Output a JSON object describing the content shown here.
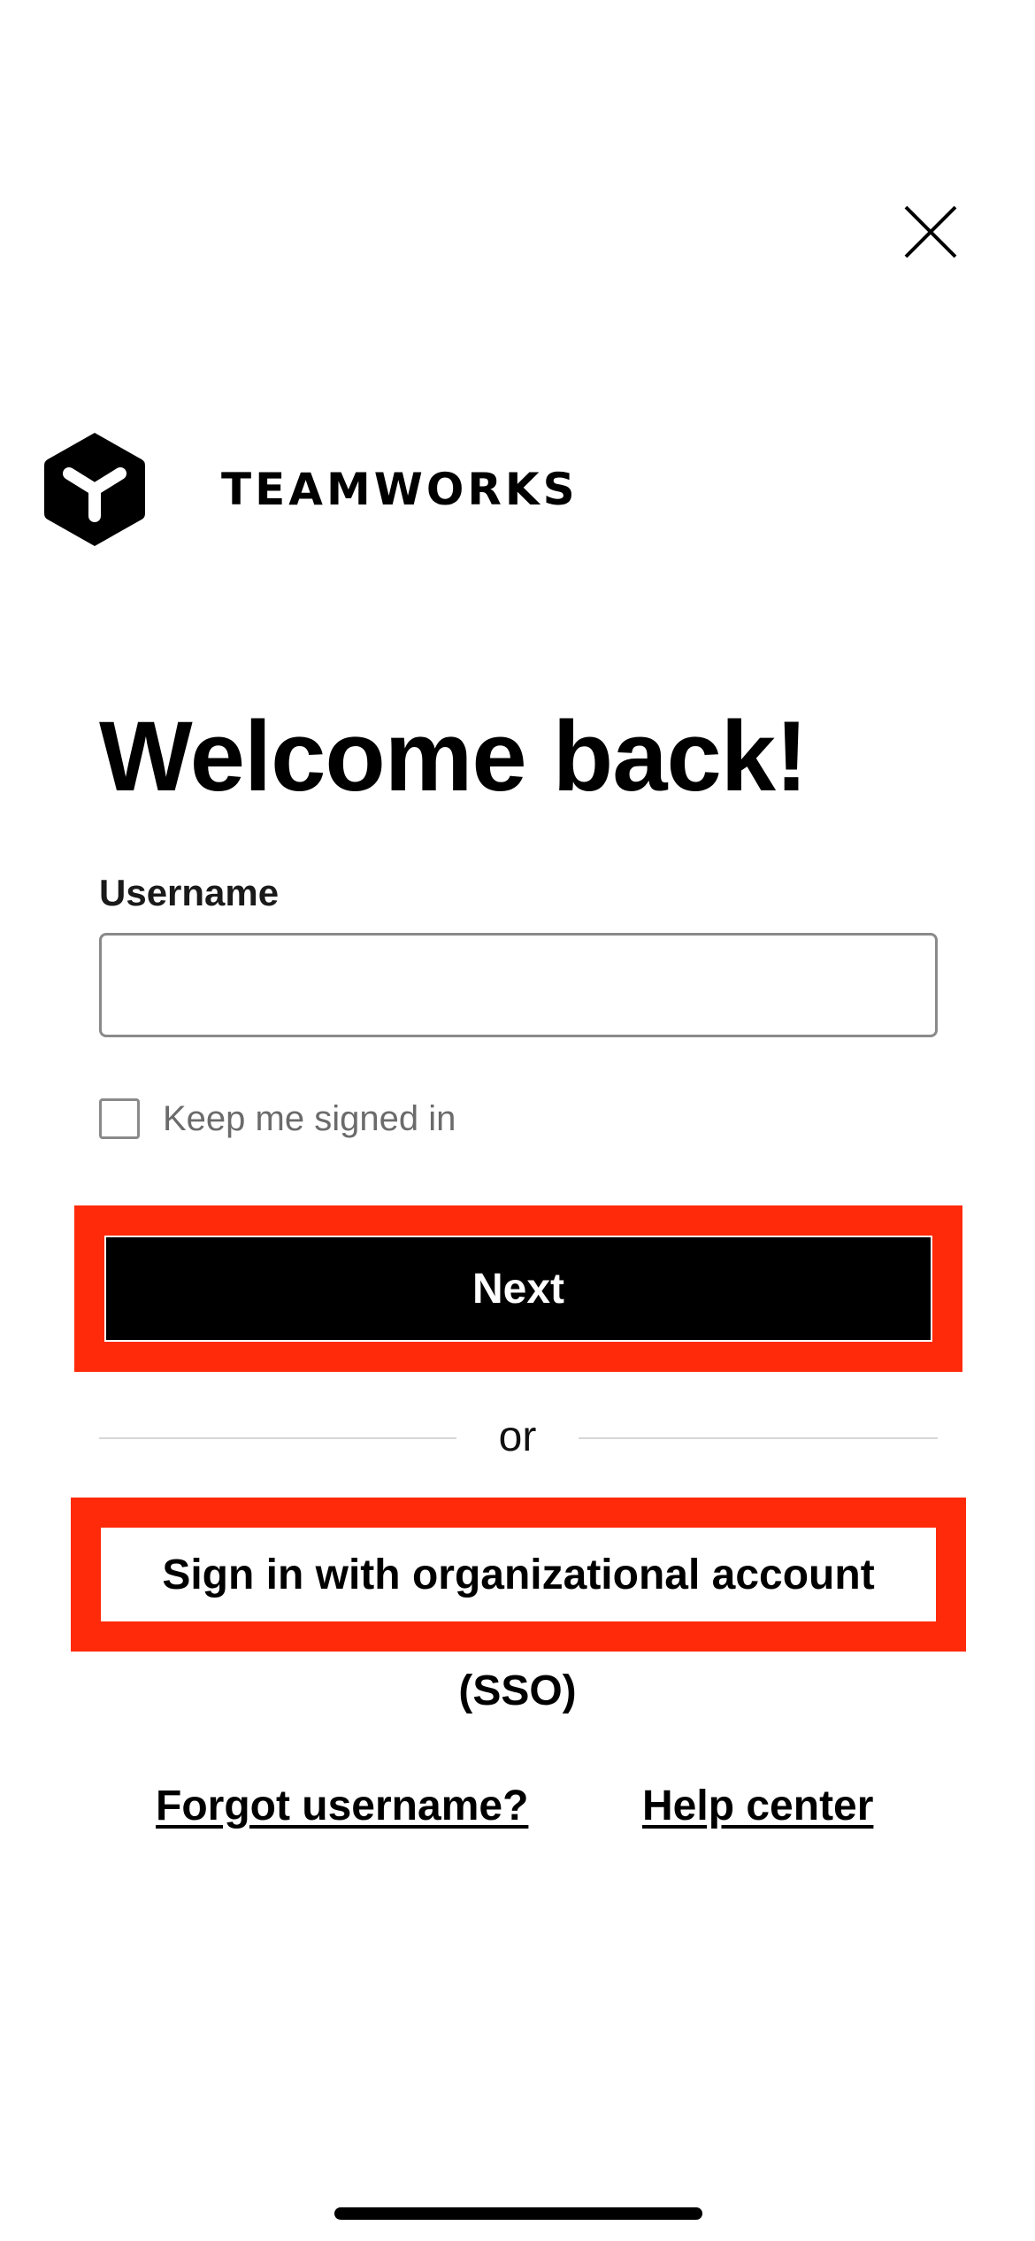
{
  "close": {
    "icon": "close-icon"
  },
  "logo": {
    "icon": "teamworks-logo-mark",
    "text": "TEAMWORKS"
  },
  "welcome": {
    "title": "Welcome back!"
  },
  "username": {
    "label": "Username",
    "value": "",
    "placeholder": ""
  },
  "keep_signed_in": {
    "label": "Keep me signed in",
    "checked": false
  },
  "next_button": {
    "label": "Next"
  },
  "divider": {
    "text": "or"
  },
  "sso": {
    "label": "Sign in with organizational account",
    "sub": "(SSO)"
  },
  "links": {
    "forgot": "Forgot username?",
    "help": "Help center"
  },
  "colors": {
    "highlight": "#ff2a0a",
    "primary_button": "#000000",
    "text": "#000000"
  }
}
